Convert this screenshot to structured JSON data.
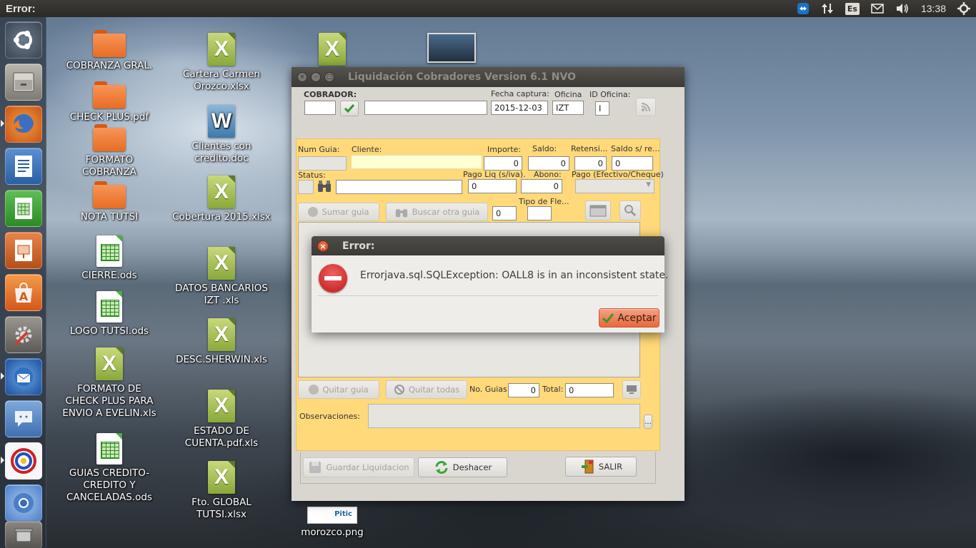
{
  "top_panel": {
    "title": "Error:",
    "keyboard_layout": "Es",
    "clock": "13:38"
  },
  "launcher": {
    "items": [
      "Ubuntu Dash",
      "Files",
      "Firefox",
      "LibreOffice Writer",
      "LibreOffice Calc",
      "LibreOffice Impress",
      "Ubuntu Software Center",
      "System Settings",
      "Thunderbird",
      "Empathy",
      "Application",
      "Chromium",
      "Trash"
    ]
  },
  "desktop": {
    "icons": [
      {
        "label": "COBRANZA GRAL."
      },
      {
        "label": "CHECK PLUS.pdf"
      },
      {
        "label": "FORMATO COBRANZA"
      },
      {
        "label": "NOTA TUTSI"
      },
      {
        "label": "CIERRE.ods"
      },
      {
        "label": "LOGO TUTSI.ods"
      },
      {
        "label": "FORMATO DE CHECK PLUS PARA ENVIO A EVELIN.xls"
      },
      {
        "label": "GUIAS CREDITO-CREDITO Y CANCELADAS.ods"
      },
      {
        "label": "Cartera Carmen Orozco.xlsx"
      },
      {
        "label": "Clientes con credito.doc"
      },
      {
        "label": "Cobertura  2015.xlsx"
      },
      {
        "label": "DATOS BANCARIOS IZT .xls"
      },
      {
        "label": "DESC.SHERWIN.xls"
      },
      {
        "label": "ESTADO DE CUENTA.pdf.xls"
      },
      {
        "label": "Fto. GLOBAL TUTSI.xlsx"
      },
      {
        "label": "morozco.png"
      }
    ],
    "png_thumb_text": "Pitic"
  },
  "app_window": {
    "title": "Liquidación Cobradores Version 6.1 NVO",
    "cobrador_label": "COBRADOR:",
    "fecha_captura_label": "Fecha captura:",
    "fecha_captura_value": "2015-12-03",
    "oficina_label": "Oficina",
    "oficina_value": "IZT",
    "id_oficina_label": "ID Oficina:",
    "id_oficina_value": "I",
    "num_guia_label": "Num Guia:",
    "cliente_label": "Cliente:",
    "importe_label": "Importe:",
    "importe_value": "0",
    "saldo_label": "Saldo:",
    "saldo_value": "0",
    "retension_label": "Retensi...",
    "retension_value": "0",
    "saldo_sre_label": "Saldo s/ re...",
    "saldo_sre_value": "0",
    "status_label": "Status:",
    "pago_liq_label": "Pago Liq (s/iva).",
    "pago_liq_value": "0",
    "abono_label": "Abono:",
    "abono_value": "0",
    "pago_tipo_label": "Pago (Efectivo/Cheque)",
    "sumar_guia": "Sumar guia",
    "buscar_otra_guia": "Buscar otra guia",
    "counter_value": "0",
    "tipo_flete_label": "Tipo de Fle...",
    "quitar_guia": "Quitar guia",
    "quitar_todas": "Quitar todas",
    "no_guias_label": "No. Guias",
    "no_guias_value": "0",
    "total_label": "Total:",
    "total_value": "0",
    "observaciones_label": "Observaciones:",
    "observaciones_more": "...",
    "guardar_liquidacion": "Guardar Liquidacion",
    "deshacer": "Deshacer",
    "salir": "SALIR"
  },
  "error_dialog": {
    "title": "Error:",
    "message": "Errorjava.sql.SQLException: OALL8 is in an inconsistent state.",
    "accept_label": "Aceptar"
  }
}
